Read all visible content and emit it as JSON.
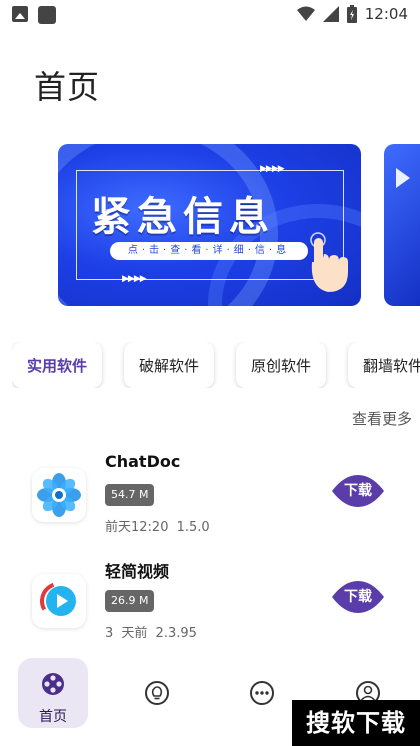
{
  "status_bar": {
    "time": "12:04"
  },
  "page": {
    "title": "首页"
  },
  "banner": {
    "title": "紧急信息",
    "subtitle": "点·击·查·看·详·细·信·息"
  },
  "categories": [
    {
      "label": "实用软件",
      "active": true
    },
    {
      "label": "破解软件",
      "active": false
    },
    {
      "label": "原创软件",
      "active": false
    },
    {
      "label": "翻墙软件",
      "active": false
    }
  ],
  "see_more_label": "查看更多",
  "apps": [
    {
      "name": "ChatDoc",
      "size": "54.7 M",
      "date": "前天12:20",
      "version": "1.5.0",
      "download_label": "下载"
    },
    {
      "name": "轻简视频",
      "size": "26.9 M",
      "date": "3 天前",
      "version": "2.3.95",
      "download_label": "下载"
    }
  ],
  "bottom_nav": {
    "home_label": "首页"
  },
  "watermark": "搜软下载",
  "colors": {
    "accent": "#5a3da8",
    "banner_blue": "#1d3fe6",
    "nav_active_bg": "#ebe6f3"
  }
}
